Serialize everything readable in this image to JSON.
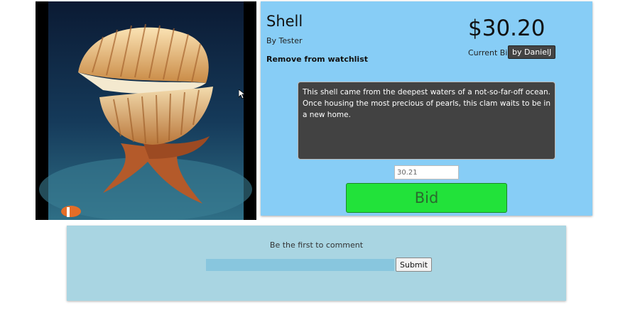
{
  "item": {
    "title": "Shell",
    "byline": "By Tester",
    "watchlist_link": "Remove from watchlist",
    "image_alt": "Clam shell on a wooden stand",
    "description": "This shell came from the deepest waters of a not-so-far-off ocean. Once housing the most precious of pearls, this clam waits to be in a new home."
  },
  "bidding": {
    "price": "$30.20",
    "current_bid_label": "Current Bid",
    "bidder_badge": "by DanielJ",
    "bid_input_value": "30.21",
    "bid_button_label": "Bid"
  },
  "comments": {
    "prompt": "Be the first to comment",
    "input_value": "",
    "submit_label": "Submit"
  },
  "colors": {
    "info_panel": "#87cdf6",
    "description_bg": "#424242",
    "bid_button": "#22e23a",
    "comment_panel": "#a9d5e2",
    "comment_input": "#88c6de"
  }
}
